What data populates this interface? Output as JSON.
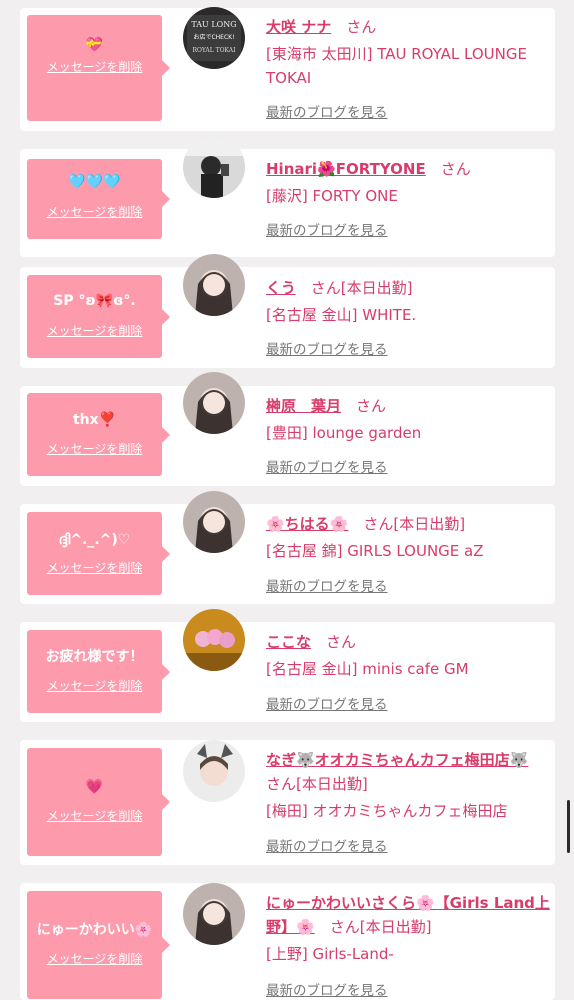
{
  "items": [
    {
      "message": "💝",
      "delete_label": "メッセージを削除",
      "name": "大咲 ナナ",
      "honorific": "さん",
      "status": "",
      "shop": "[東海市 太田川] TAU ROYAL LOUNGE TOKAI",
      "blog_label": "最新のブログを見る",
      "avatar": "avatar-tau-logo"
    },
    {
      "message": "🩵🩵🩵",
      "delete_label": "メッセージを削除",
      "name": "Hinari🌺FORTYONE",
      "honorific": "さん",
      "status": "",
      "shop": "[藤沢] FORTY ONE",
      "blog_label": "最新のブログを見る",
      "avatar": "avatar-mirror-selfie"
    },
    {
      "message": "SP °ʚ🎀ɞ°.",
      "delete_label": "メッセージを削除",
      "name": "くう",
      "honorific": "さん",
      "status": "[本日出勤]",
      "shop": "[名古屋 金山] WHITE.",
      "blog_label": "最新のブログを見る",
      "avatar": "avatar-selfie"
    },
    {
      "message": "thx❣️",
      "delete_label": "メッセージを削除",
      "name": "榊原　葉月",
      "honorific": "さん",
      "status": "",
      "shop": "[豊田] lounge garden",
      "blog_label": "最新のブログを見る",
      "avatar": "avatar-selfie"
    },
    {
      "message": "ദ്ദി^._.^)♡",
      "delete_label": "メッセージを削除",
      "name": "🌸ちはる🌸",
      "honorific": "さん",
      "status": "[本日出勤]",
      "shop": "[名古屋 錦] GIRLS LOUNGE aZ",
      "blog_label": "最新のブログを見る",
      "avatar": "avatar-selfie"
    },
    {
      "message": "お疲れ様です！",
      "delete_label": "メッセージを削除",
      "name": "ここな",
      "honorific": "さん",
      "status": "",
      "shop": "[名古屋 金山] minis cafe GM",
      "blog_label": "最新のブログを見る",
      "avatar": "avatar-drinks"
    },
    {
      "message": "💗",
      "delete_label": "メッセージを削除",
      "name": "なぎ🐺オオカミちゃんカフェ梅田店🐺",
      "honorific": "さん",
      "status": "[本日出勤]",
      "shop": "[梅田] オオカミちゃんカフェ梅田店",
      "blog_label": "最新のブログを見る",
      "avatar": "avatar-wolf-ears"
    },
    {
      "message": "にゅーかわいい🌸",
      "delete_label": "メッセージを削除",
      "name": "にゅーかわいいさくら🌸【Girls Land上野】🌸",
      "honorific": "さん",
      "status": "[本日出勤]",
      "shop": "[上野] Girls-Land-",
      "blog_label": "最新のブログを見る",
      "avatar": "avatar-selfie"
    }
  ],
  "logo_text": [
    "TAU LONG",
    "お店でCHECK!",
    "ROYAL TOKAI"
  ],
  "colors": {
    "accent": "#d83c6a",
    "bubble": "#fd9bad",
    "background": "#f1eff0"
  }
}
